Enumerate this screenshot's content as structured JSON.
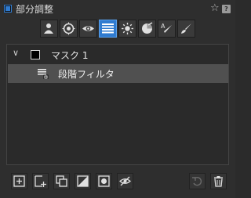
{
  "header": {
    "title": "部分調整",
    "star_icon": "star-icon",
    "help_label": "?"
  },
  "toolbar": {
    "tools": [
      {
        "icon": "person-icon",
        "active": false
      },
      {
        "icon": "target-icon",
        "active": false
      },
      {
        "icon": "eye-icon",
        "active": false
      },
      {
        "icon": "gradient-filter-icon",
        "active": true
      },
      {
        "icon": "sun-icon",
        "active": false
      },
      {
        "icon": "color-wheel-icon",
        "active": false
      },
      {
        "icon": "text-brush-icon",
        "active": false
      },
      {
        "icon": "brush-icon",
        "active": false
      }
    ]
  },
  "list": {
    "mask": {
      "label": "マスク 1",
      "expanded": true
    },
    "filter": {
      "label": "段階フィルタ",
      "selected": true
    }
  },
  "bottom_buttons": {
    "left": [
      "add-icon",
      "add-layer-icon",
      "duplicate-icon",
      "invert-icon",
      "circle-mask-icon",
      "hidden-eye-icon"
    ],
    "right": [
      "undo-icon",
      "trash-icon"
    ]
  },
  "colors": {
    "accent": "#2f7bd0",
    "background": "#2e2e2e",
    "selection": "#505050"
  }
}
